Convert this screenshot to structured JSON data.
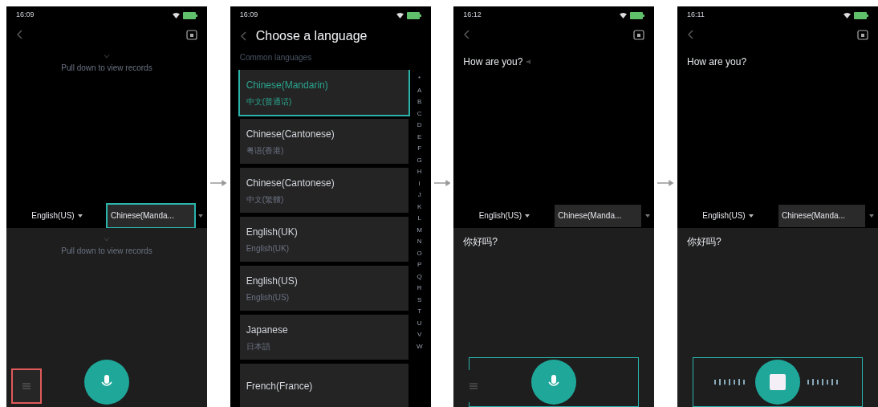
{
  "screens": [
    {
      "kind": "translator",
      "time": "16:09",
      "input_hint": "Pull down to view records",
      "source_language": "English(US)",
      "target_language": "Chinese(Manda...",
      "target_highlighted": true,
      "output_hint": "Pull down to view records",
      "history_highlighted": true,
      "recording": false
    },
    {
      "kind": "language_list",
      "time": "16:09",
      "title": "Choose a language",
      "section": "Common languages",
      "items": [
        {
          "name": "Chinese(Mandarin)",
          "native": "中文(普通话)",
          "selected": true
        },
        {
          "name": "Chinese(Cantonese)",
          "native": "粤语(香港)",
          "selected": false
        },
        {
          "name": "Chinese(Cantonese)",
          "native": "中文(繁體)",
          "selected": false
        },
        {
          "name": "English(UK)",
          "native": "English(UK)",
          "selected": false
        },
        {
          "name": "English(US)",
          "native": "English(US)",
          "selected": false
        },
        {
          "name": "Japanese",
          "native": "日本語",
          "selected": false
        },
        {
          "name": "French(France)",
          "selected": false
        }
      ],
      "index": [
        "*",
        "A",
        "B",
        "C",
        "D",
        "E",
        "F",
        "G",
        "H",
        "I",
        "J",
        "K",
        "L",
        "M",
        "N",
        "O",
        "P",
        "Q",
        "R",
        "S",
        "T",
        "U",
        "V",
        "W"
      ]
    },
    {
      "kind": "translator",
      "time": "16:12",
      "input_text": "How are you?",
      "source_language": "English(US)",
      "target_language": "Chinese(Manda...",
      "target_highlighted": false,
      "output_text": "你好吗?",
      "recording": false,
      "controls_highlighted": true
    },
    {
      "kind": "translator",
      "time": "16:11",
      "input_text": "How are you?",
      "source_language": "English(US)",
      "target_language": "Chinese(Manda...",
      "target_highlighted": false,
      "output_text": "你好吗?",
      "recording": true,
      "controls_highlighted": true
    }
  ]
}
